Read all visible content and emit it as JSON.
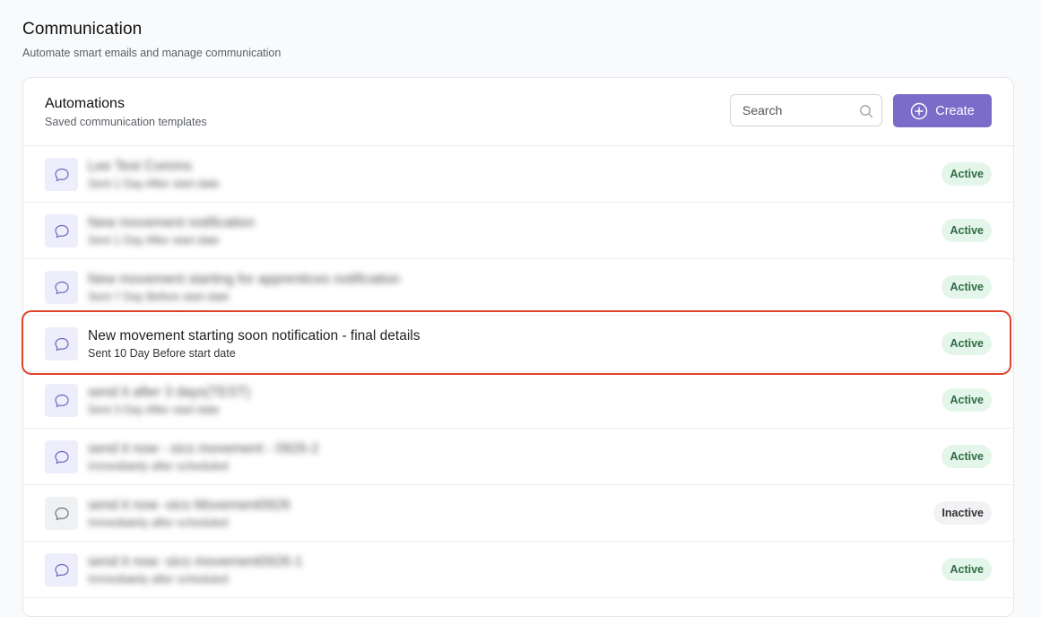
{
  "page": {
    "title": "Communication",
    "subtitle": "Automate smart emails and manage communication"
  },
  "panel": {
    "title": "Automations",
    "subtitle": "Saved communication templates",
    "search_placeholder": "Search",
    "create_label": "Create"
  },
  "colors": {
    "accent": "#7b6cc9",
    "active_badge_bg": "#e4f6ea",
    "active_badge_text": "#2f6b43",
    "highlight_border": "#e0432c"
  },
  "automations": [
    {
      "title": "Lee Test Comms",
      "subtitle": "Sent 1 Day After start date",
      "status": "Active"
    },
    {
      "title": "New movement notification",
      "subtitle": "Sent 1 Day After start date",
      "status": "Active"
    },
    {
      "title": "New movement starting for apprentices notification",
      "subtitle": "Sent 7 Day Before start date",
      "status": "Active"
    },
    {
      "title": "New movement starting soon notification - final details",
      "subtitle": "Sent 10 Day Before start date",
      "status": "Active"
    },
    {
      "title": "send it after 3 days(TEST)",
      "subtitle": "Sent 3 Day After start date",
      "status": "Active"
    },
    {
      "title": "send it now - sics movement - 0926-2",
      "subtitle": "Immediately after scheduled",
      "status": "Active"
    },
    {
      "title": "send it now -sics Movement0926",
      "subtitle": "Immediately after scheduled",
      "status": "Inactive"
    },
    {
      "title": "send it now -sics movement0926-1",
      "subtitle": "Immediately after scheduled",
      "status": "Active"
    }
  ]
}
